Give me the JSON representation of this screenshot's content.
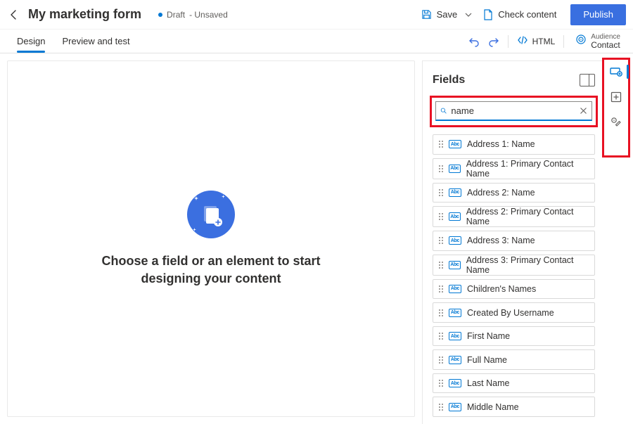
{
  "header": {
    "title": "My marketing form",
    "status_badge": "Draft",
    "status_suffix": "- Unsaved",
    "save_label": "Save",
    "check_label": "Check content",
    "publish_label": "Publish"
  },
  "tabs": {
    "design": "Design",
    "preview": "Preview and test"
  },
  "toolbar": {
    "html_label": "HTML",
    "audience_label": "Audience",
    "audience_value": "Contact"
  },
  "canvas": {
    "empty_title": "Choose a field or an element to start",
    "empty_sub": "designing your content"
  },
  "panel": {
    "title": "Fields",
    "search_value": "name",
    "field_type_abbr": "Abc",
    "items": [
      "Address 1: Name",
      "Address 1: Primary Contact Name",
      "Address 2: Name",
      "Address 2: Primary Contact Name",
      "Address 3: Name",
      "Address 3: Primary Contact Name",
      "Children's Names",
      "Created By Username",
      "First Name",
      "Full Name",
      "Last Name",
      "Middle Name"
    ]
  }
}
